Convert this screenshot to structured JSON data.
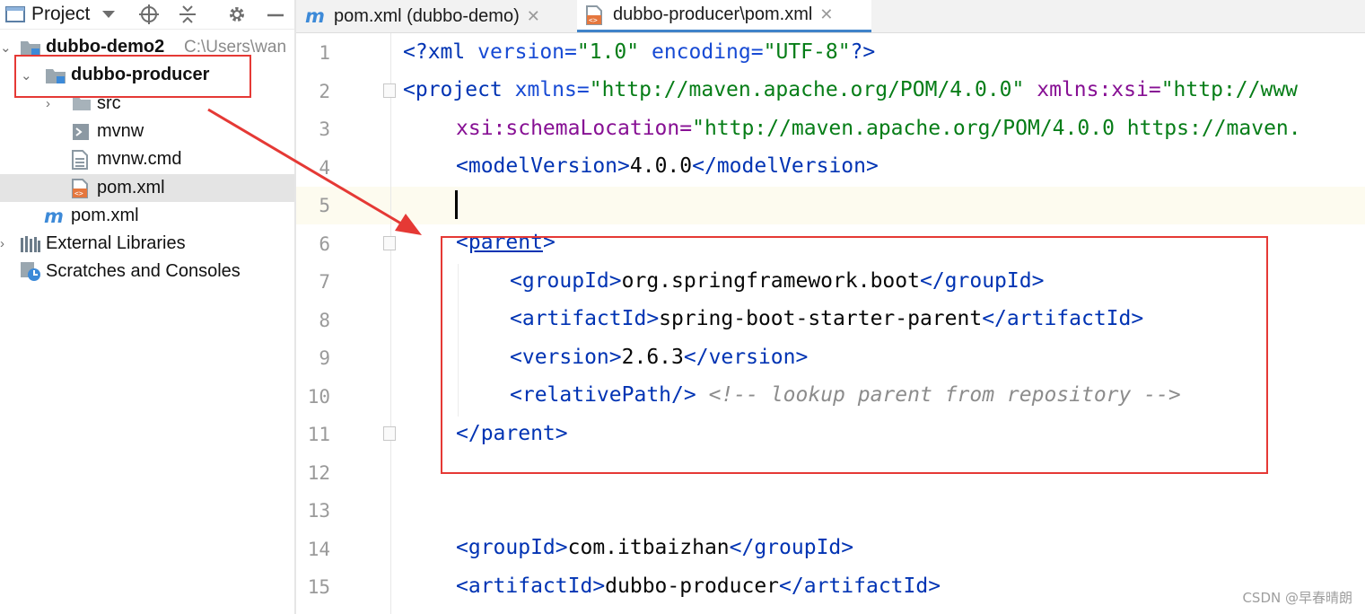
{
  "toolbar": {
    "project_label": "Project"
  },
  "tree": {
    "root": {
      "label": "dubbo-demo2",
      "path": "C:\\Users\\wan"
    },
    "module": {
      "label": "dubbo-producer"
    },
    "items": [
      {
        "label": "src"
      },
      {
        "label": "mvnw"
      },
      {
        "label": "mvnw.cmd"
      },
      {
        "label": "pom.xml"
      }
    ],
    "root_pom": {
      "label": "pom.xml"
    },
    "external": {
      "label": "External Libraries"
    },
    "scratches": {
      "label": "Scratches and Consoles"
    }
  },
  "tabs": [
    {
      "label": "pom.xml (dubbo-demo)"
    },
    {
      "label": "dubbo-producer\\pom.xml"
    }
  ],
  "editor": {
    "line_numbers": [
      "1",
      "2",
      "3",
      "4",
      "5",
      "6",
      "7",
      "8",
      "9",
      "10",
      "11",
      "12",
      "13",
      "14",
      "15"
    ],
    "lines": {
      "l1": {
        "open": "<?xml",
        "attrs": " version=",
        "v1": "\"1.0\"",
        "attrs2": " encoding=",
        "v2": "\"UTF-8\"",
        "close": "?>"
      },
      "l2": {
        "tag": "<project",
        "a1": " xmlns=",
        "v1": "\"http://maven.apache.org/POM/4.0.0\"",
        "ns": " xmlns:xsi=",
        "v2": "\"http://www"
      },
      "l3": {
        "ns": "xsi:schemaLocation=",
        "v": "\"http://maven.apache.org/POM/4.0.0 https://maven."
      },
      "l4": {
        "open": "<modelVersion>",
        "text": "4.0.0",
        "close": "</modelVersion>"
      },
      "l6": {
        "lt": "<",
        "name": "parent",
        "gt": ">"
      },
      "l7": {
        "open": "<groupId>",
        "text": "org.springframework.boot",
        "close": "</groupId>"
      },
      "l8": {
        "open": "<artifactId>",
        "text": "spring-boot-starter-parent",
        "close": "</artifactId>"
      },
      "l9": {
        "open": "<version>",
        "text": "2.6.3",
        "close": "</version>"
      },
      "l10": {
        "tag": "<relativePath/>",
        "comment": " <!-- lookup parent from repository -->"
      },
      "l11": {
        "tag": "</parent>"
      },
      "l14": {
        "open": "<groupId>",
        "text": "com.itbaizhan",
        "close": "</groupId>"
      },
      "l15": {
        "open": "<artifactId>",
        "text": "dubbo-producer",
        "close": "</artifactId>"
      }
    }
  },
  "watermark": "CSDN @早春晴朗",
  "colors": {
    "annotation_red": "#e53935",
    "tab_accent": "#4083c9"
  }
}
